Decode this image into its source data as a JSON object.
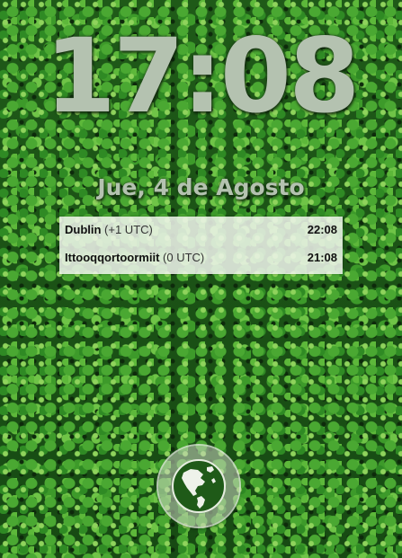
{
  "clock": {
    "time": "17:08",
    "date": "Jue, 4 de Agosto"
  },
  "world_clock": {
    "rows": [
      {
        "city": "Dublin",
        "offset": " (+1 UTC)",
        "time": "22:08"
      },
      {
        "city": "Ittooqqortoormiit",
        "offset": " (0 UTC)",
        "time": "21:08"
      }
    ]
  },
  "globe_button": {
    "icon": "globe-icon"
  },
  "colors": {
    "clock_text": "#b4c2b0",
    "panel_background": "#f0f4ec",
    "globe_fill": "#1f5a18"
  }
}
